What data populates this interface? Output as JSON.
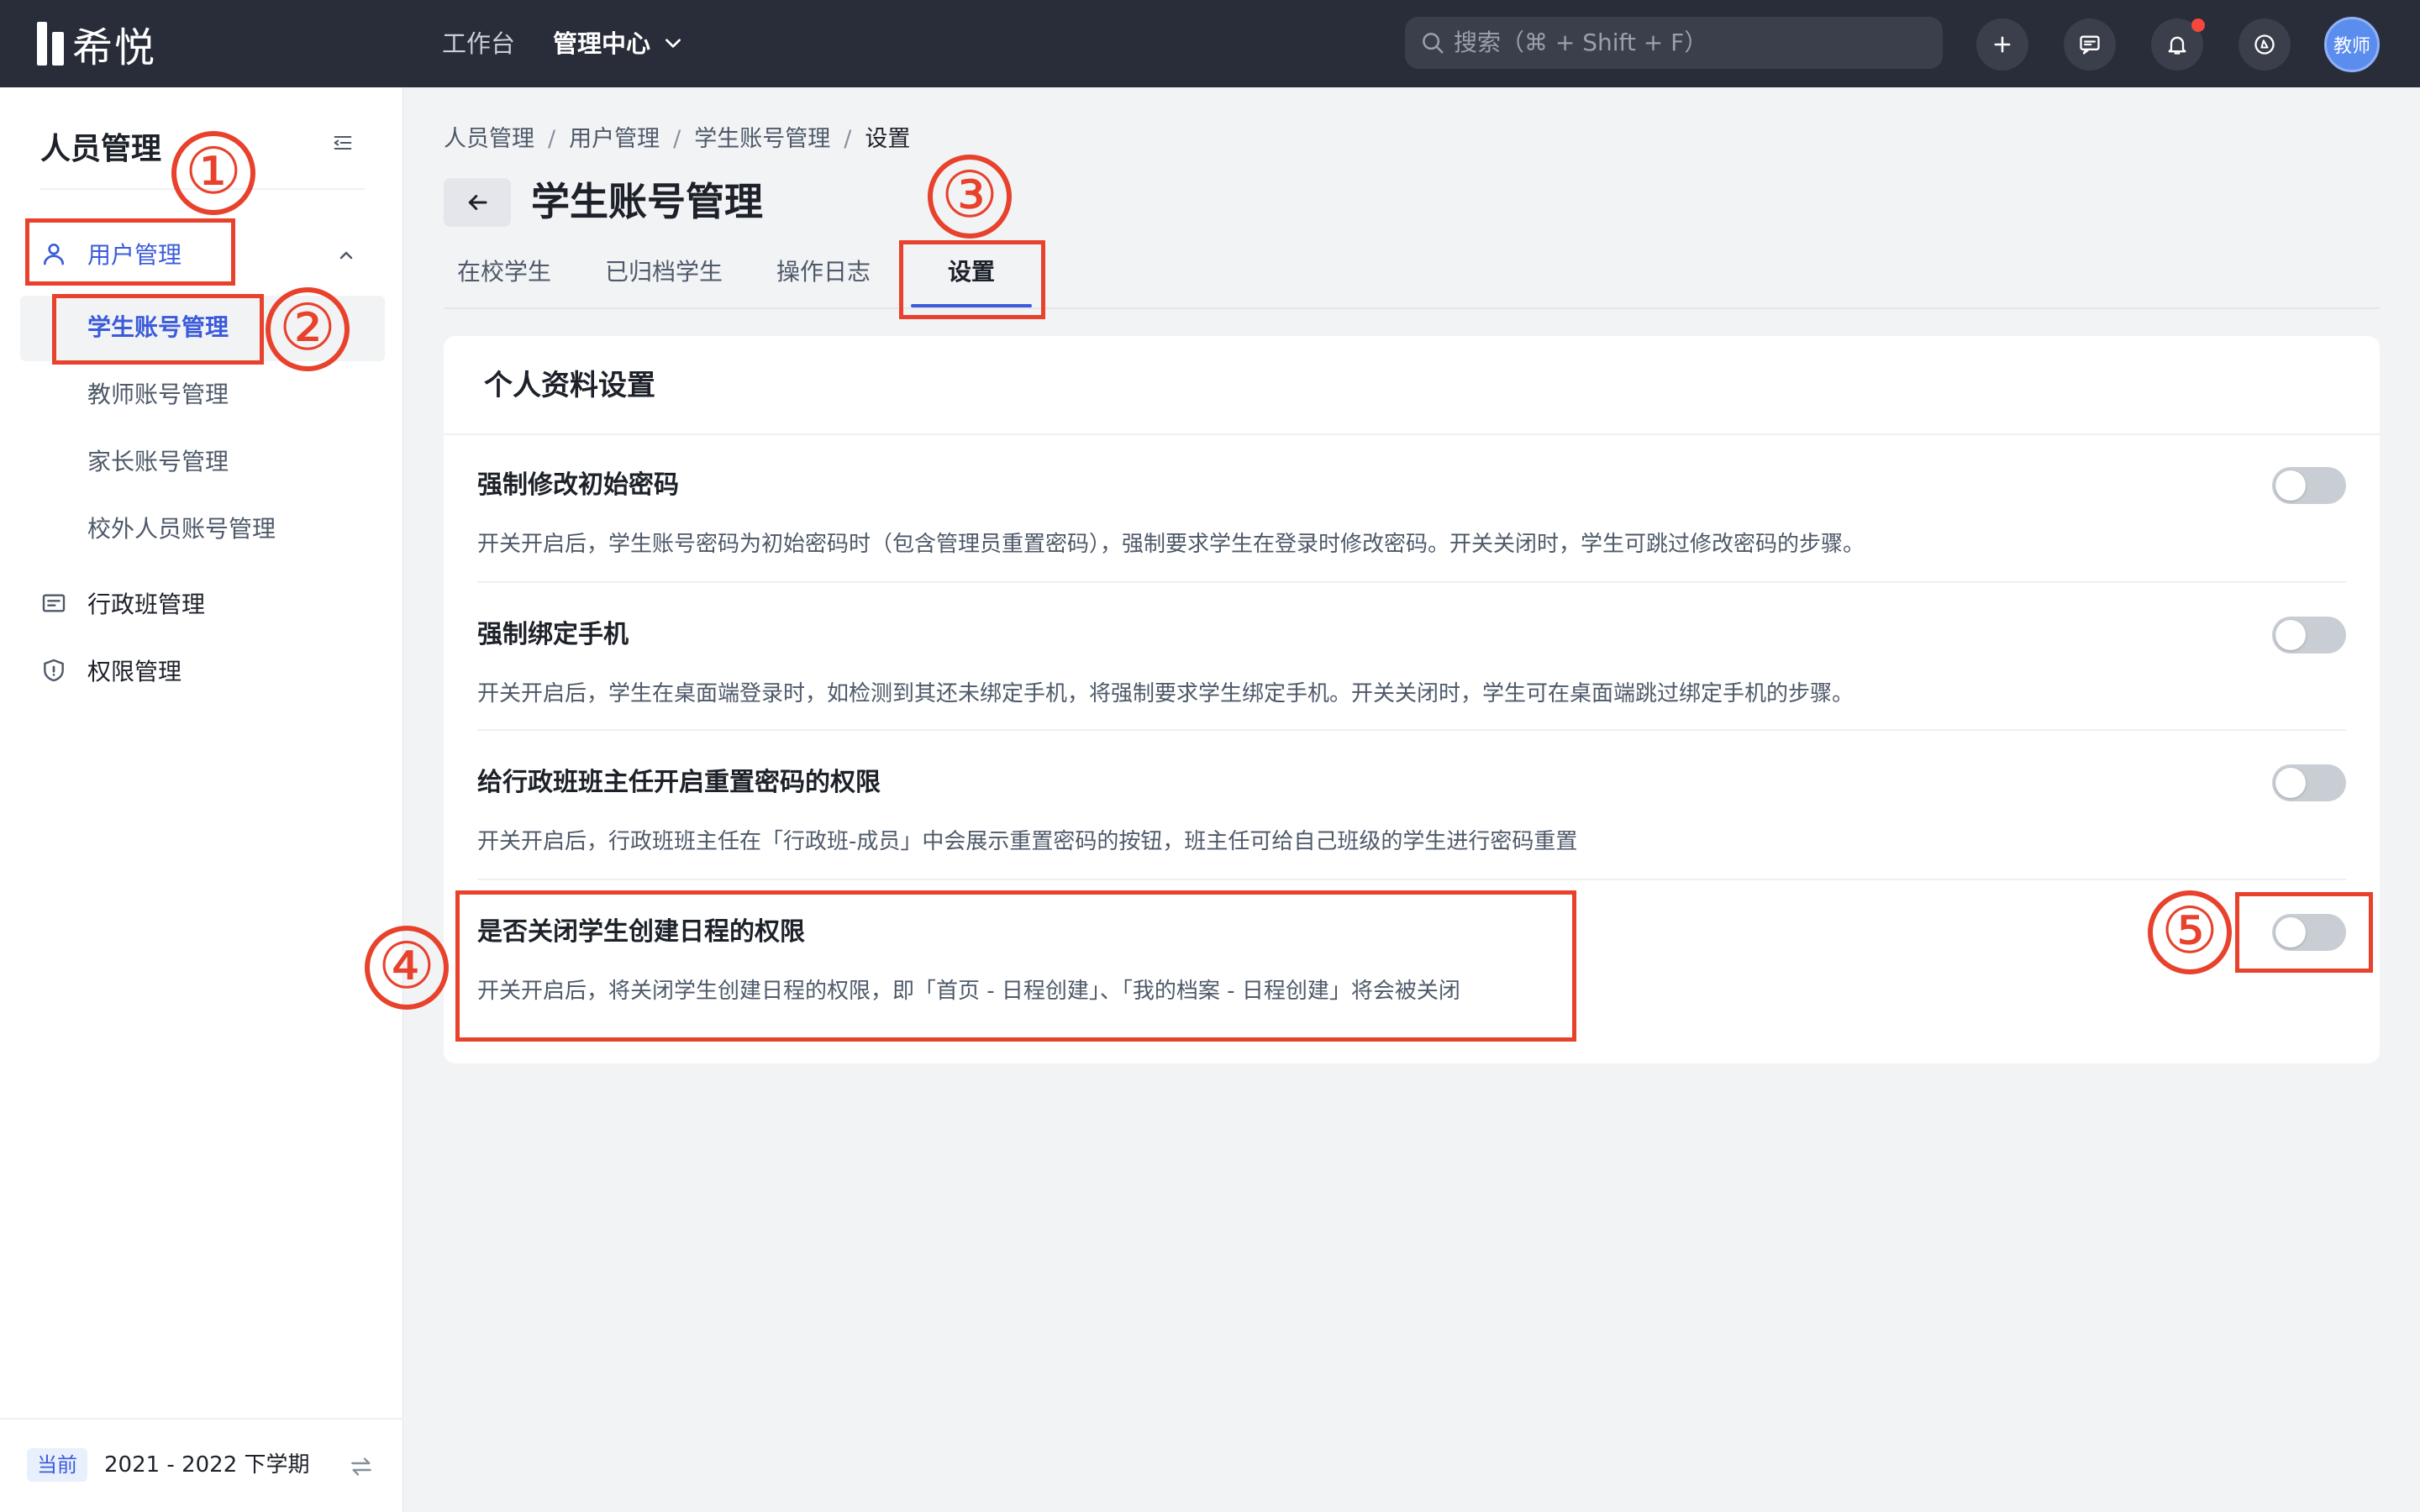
{
  "topbar": {
    "logo_text": "希悦",
    "nav": [
      "工作台",
      "管理中心"
    ],
    "search_placeholder": "搜索（⌘ + Shift + F）",
    "avatar_text": "教师"
  },
  "sidebar": {
    "title": "人员管理",
    "menu": {
      "user_mgmt": "用户管理",
      "sub": [
        "学生账号管理",
        "教师账号管理",
        "家长账号管理",
        "校外人员账号管理"
      ],
      "class_mgmt": "行政班管理",
      "perm_mgmt": "权限管理"
    },
    "footer": {
      "badge": "当前",
      "term": "2021 - 2022 下学期"
    }
  },
  "main": {
    "breadcrumb": [
      "人员管理",
      "用户管理",
      "学生账号管理",
      "设置"
    ],
    "page_title": "学生账号管理",
    "tabs": [
      "在校学生",
      "已归档学生",
      "操作日志",
      "设置"
    ],
    "active_tab": "设置",
    "card": {
      "title": "个人资料设置",
      "settings": [
        {
          "title": "强制修改初始密码",
          "desc": "开关开启后，学生账号密码为初始密码时（包含管理员重置密码），强制要求学生在登录时修改密码。开关关闭时，学生可跳过修改密码的步骤。",
          "enabled": false
        },
        {
          "title": "强制绑定手机",
          "desc": "开关开启后，学生在桌面端登录时，如检测到其还未绑定手机，将强制要求学生绑定手机。开关关闭时，学生可在桌面端跳过绑定手机的步骤。",
          "enabled": false
        },
        {
          "title": "给行政班班主任开启重置密码的权限",
          "desc": "开关开启后，行政班班主任在「行政班-成员」中会展示重置密码的按钮，班主任可给自己班级的学生进行密码重置",
          "enabled": false
        },
        {
          "title": "是否关闭学生创建日程的权限",
          "desc": "开关开启后，将关闭学生创建日程的权限，即「首页 - 日程创建」、「我的档案 - 日程创建」将会被关闭",
          "enabled": false
        }
      ]
    }
  },
  "annotations": [
    "①",
    "②",
    "③",
    "④",
    "⑤"
  ],
  "colors": {
    "accent": "#3b5bdb",
    "annotation": "#e8412c",
    "topbar": "#282d39"
  }
}
